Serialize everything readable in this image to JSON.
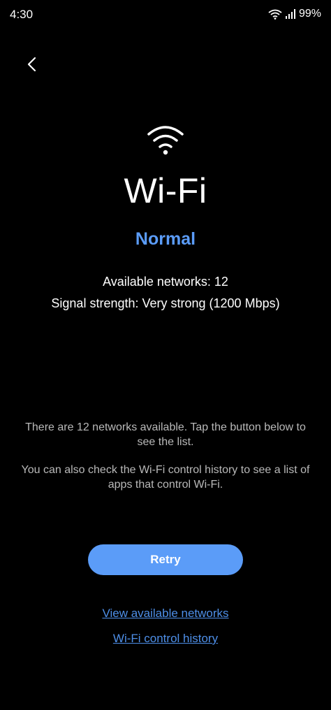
{
  "status_bar": {
    "time": "4:30",
    "battery": "99%",
    "icons": [
      "wifi-icon",
      "signal-icon"
    ]
  },
  "nav": {
    "back_icon": "chevron-left-icon"
  },
  "hero": {
    "icon": "wifi-icon",
    "title": "Wi-Fi",
    "status": "Normal",
    "status_color": "#5b9cf8"
  },
  "details": {
    "networks": "Available networks: 12",
    "signal": "Signal strength: Very strong (1200 Mbps)"
  },
  "description": {
    "paragraph1": "There are 12 networks available. Tap the button below to see the list.",
    "paragraph2": "You can also check the Wi-Fi control history to see a list of apps that control Wi-Fi."
  },
  "actions": {
    "retry_label": "Retry",
    "view_networks_label": "View available networks",
    "control_history_label": "Wi-Fi control history",
    "accent_color": "#5b9cf8",
    "link_color": "#4e8fe8"
  }
}
